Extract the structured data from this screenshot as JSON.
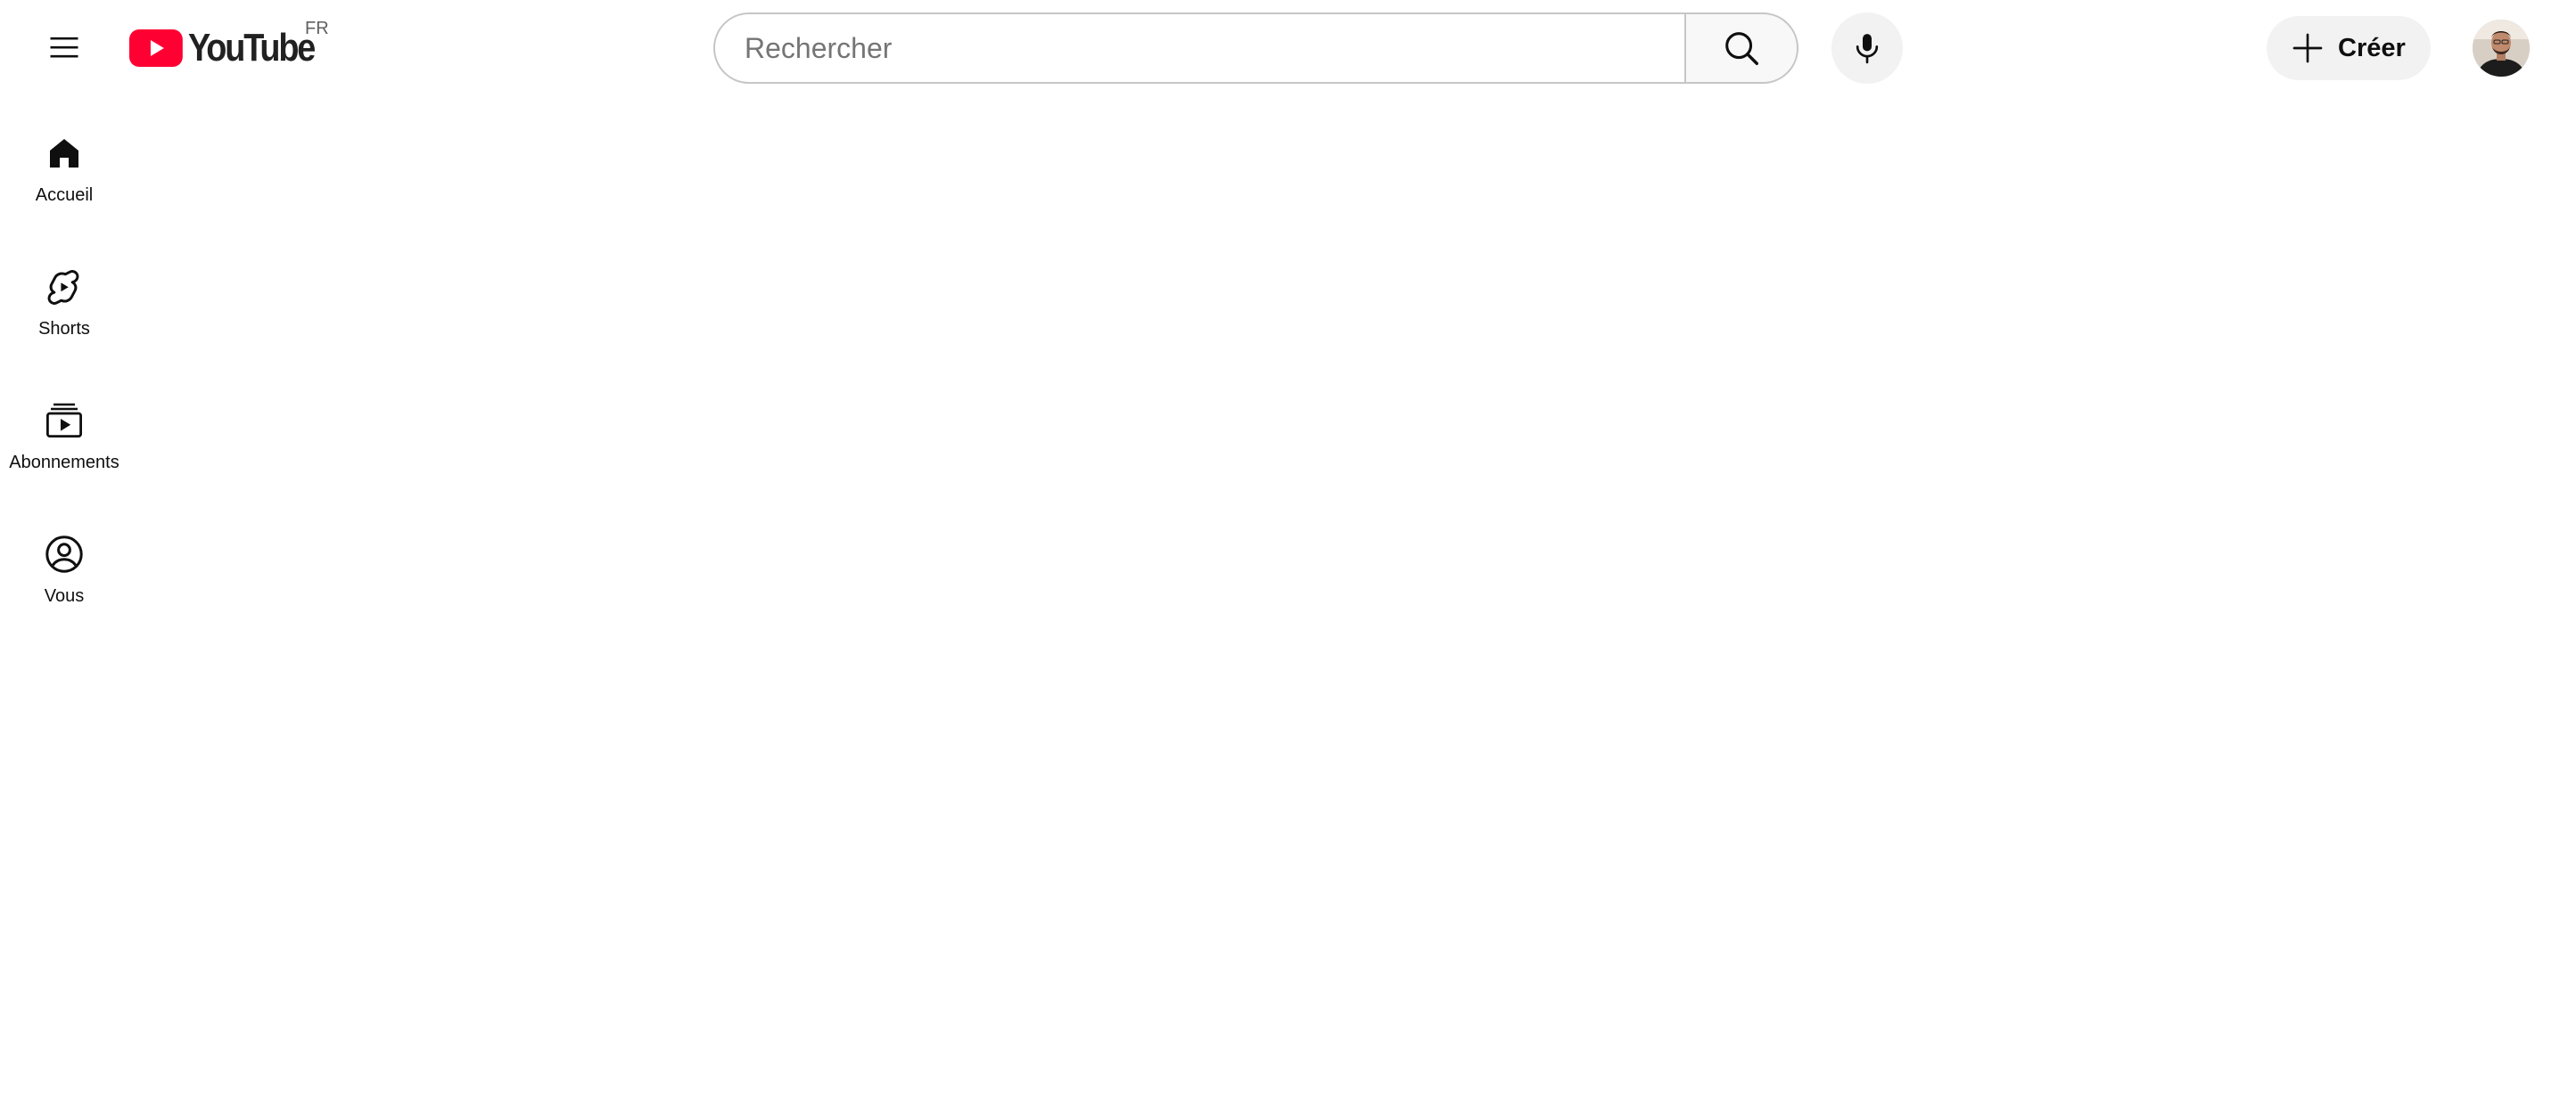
{
  "masthead": {
    "menu_icon": "hamburger-menu-icon",
    "logo": {
      "text": "YouTube",
      "country_code": "FR",
      "brand_color": "#ff0033"
    },
    "search": {
      "placeholder": "Rechercher",
      "value": "",
      "search_icon": "search-icon",
      "voice_icon": "microphone-icon"
    },
    "create_button": {
      "label": "Créer",
      "icon": "plus-icon"
    },
    "avatar_icon": "user-avatar"
  },
  "guide": {
    "items": [
      {
        "label": "Accueil",
        "icon": "home-icon"
      },
      {
        "label": "Shorts",
        "icon": "shorts-icon"
      },
      {
        "label": "Abonnements",
        "icon": "subscriptions-icon"
      },
      {
        "label": "Vous",
        "icon": "account-circle-icon"
      }
    ]
  }
}
